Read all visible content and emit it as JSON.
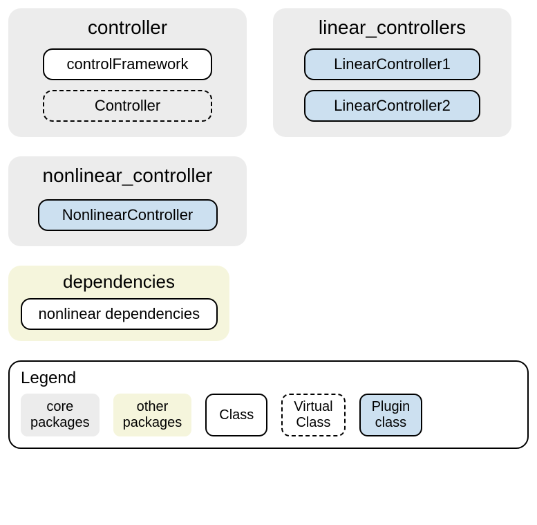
{
  "packages": {
    "controller": {
      "title": "controller",
      "items": [
        {
          "label": "controlFramework",
          "type": "class"
        },
        {
          "label": "Controller",
          "type": "virtual"
        }
      ]
    },
    "linear_controllers": {
      "title": "linear_controllers",
      "items": [
        {
          "label": "LinearController1",
          "type": "plugin"
        },
        {
          "label": "LinearController2",
          "type": "plugin"
        }
      ]
    },
    "nonlinear_controller": {
      "title": "nonlinear_controller",
      "items": [
        {
          "label": "NonlinearController",
          "type": "plugin"
        }
      ]
    },
    "dependencies": {
      "title": "dependencies",
      "items": [
        {
          "label": "nonlinear dependencies",
          "type": "class"
        }
      ]
    }
  },
  "legend": {
    "title": "Legend",
    "core_packages": "core\npackages",
    "other_packages": "other\npackages",
    "class": "Class",
    "virtual_class": "Virtual\nClass",
    "plugin_class": "Plugin\nclass"
  }
}
